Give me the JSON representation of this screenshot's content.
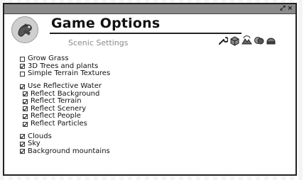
{
  "window": {
    "title": "Game Options",
    "subtitle": "Scenic Settings",
    "buttons": {
      "resize": "⤢",
      "close": "×"
    }
  },
  "toolbar_icons": [
    "wrench-icon",
    "cube-icon",
    "terrain-icon",
    "drama-icon",
    "gem-icon"
  ],
  "options": [
    {
      "label": "Grow Grass",
      "checked": false
    },
    {
      "label": "3D Trees and plants",
      "checked": true
    },
    {
      "label": "Simple Terrain Textures",
      "checked": false
    },
    {
      "label": "Use Reflective Water",
      "checked": true
    },
    {
      "label": "Reflect Background",
      "checked": true
    },
    {
      "label": "Reflect Terrain",
      "checked": true
    },
    {
      "label": "Reflect Scenery",
      "checked": true
    },
    {
      "label": "Reflect People",
      "checked": true
    },
    {
      "label": "Reflect Particles",
      "checked": true
    },
    {
      "label": "Clouds",
      "checked": true
    },
    {
      "label": "Sky",
      "checked": true
    },
    {
      "label": "Background mountains",
      "checked": true
    }
  ]
}
